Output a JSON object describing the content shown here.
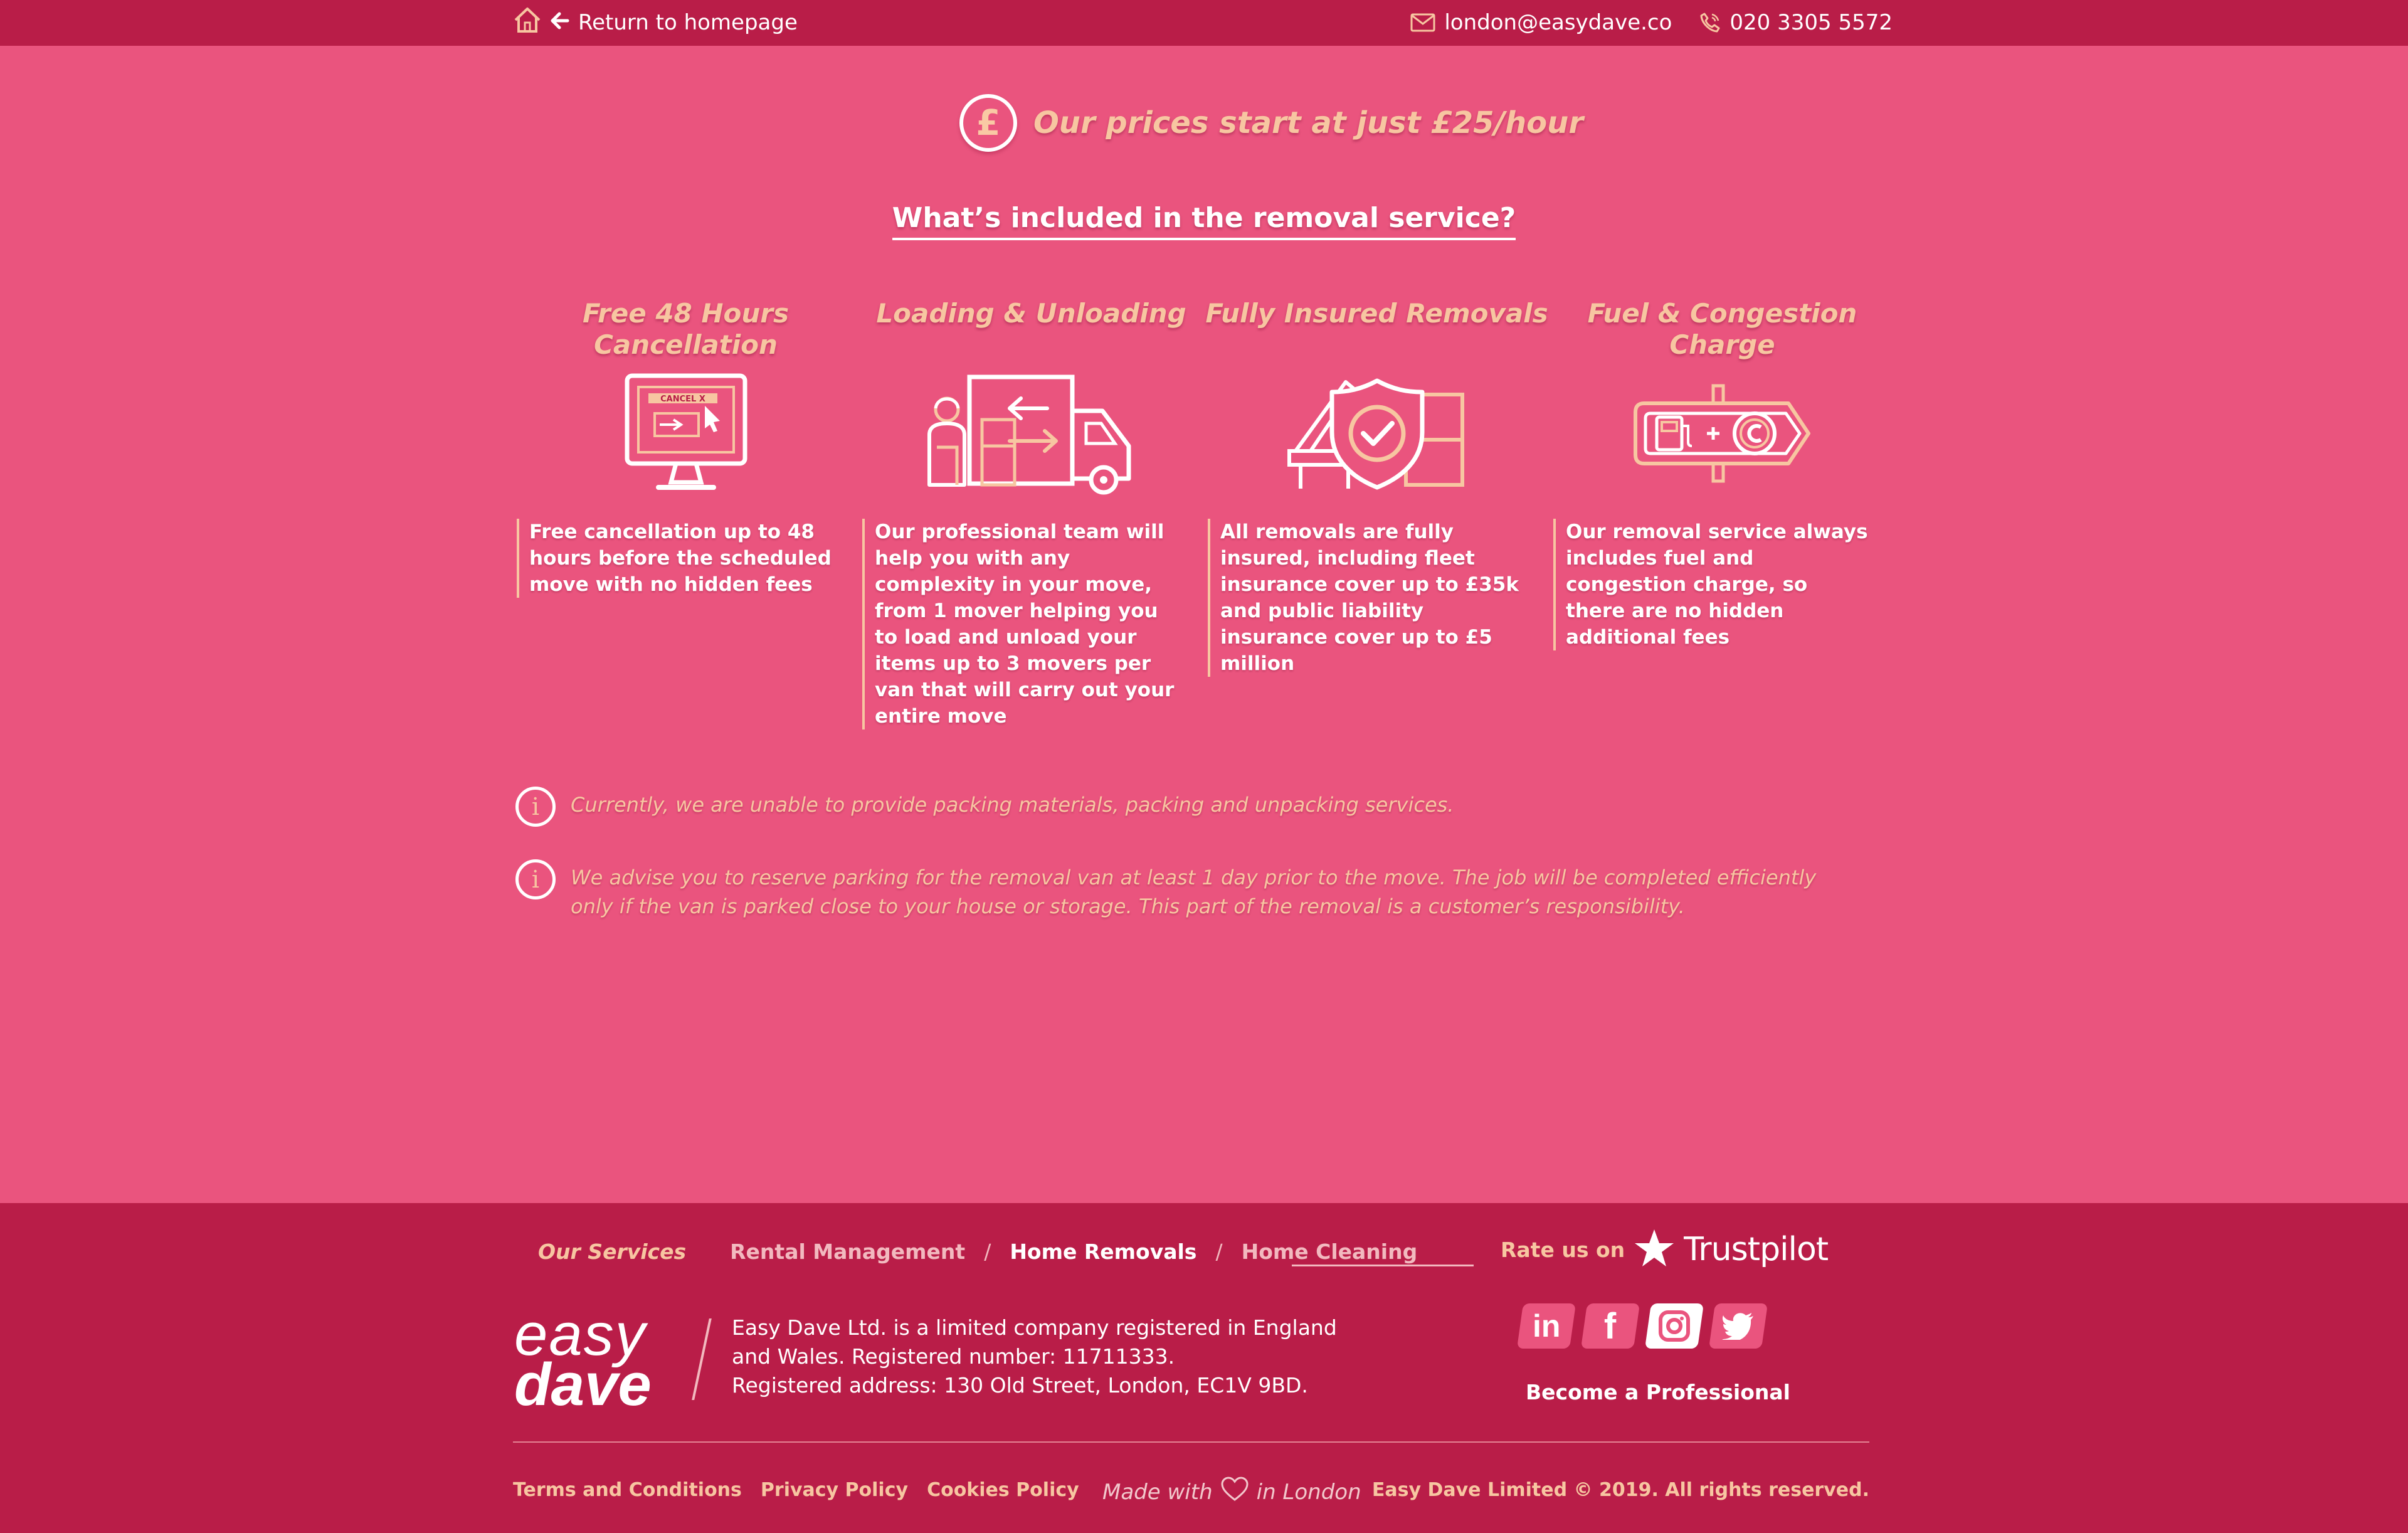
{
  "colors": {
    "page_bg": "#ea547e",
    "bar_bg": "#b91d48",
    "accent_peach": "#f7c6a1",
    "text_white": "#ffffff"
  },
  "topbar": {
    "home_icon": "home-icon",
    "back_icon": "arrow-left-icon",
    "return_label": "Return to homepage",
    "email_icon": "envelope-icon",
    "email": "london@easydave.co",
    "phone_icon": "phone-icon",
    "phone": "020 3305 5572"
  },
  "price": {
    "icon": "pound-icon",
    "symbol": "£",
    "text": "Our prices start at just £25/hour"
  },
  "included": {
    "title": "What’s included in the removal service?"
  },
  "features": [
    {
      "title": "Free 48 Hours Cancellation",
      "icon": "cancel-monitor-icon",
      "icon_text": "CANCEL X",
      "description": "Free cancellation up to 48 hours before the scheduled move with no hidden fees"
    },
    {
      "title": "Loading & Unloading",
      "icon": "mover-truck-icon",
      "description": "Our professional team will help you with any complexity in your move, from 1 mover helping you to load and unload your items up to 3 movers per van that will carry out your entire move"
    },
    {
      "title": "Fully Insured Removals",
      "icon": "shield-check-icon",
      "description": "All removals are fully insured, including fleet insurance cover up to £35k and public liability insurance cover up to £5 million"
    },
    {
      "title": "Fuel & Congestion Charge",
      "icon": "fuel-congestion-icon",
      "description": "Our removal service always includes fuel and congestion charge, so there are no hidden additional fees"
    }
  ],
  "notices": [
    {
      "icon": "info-icon",
      "text": "Currently, we are unable to provide packing materials, packing and unpacking services."
    },
    {
      "icon": "info-icon",
      "text": "We advise you to reserve parking for the removal van at least 1 day prior to the move. The job will be completed efficiently only if the van is parked close to your house or storage. This part of the removal is a customer’s responsibility."
    }
  ],
  "footer": {
    "nav_title": "Our Services",
    "nav_links": [
      "Rental Management",
      "Home Removals",
      "Home Cleaning"
    ],
    "nav_active": "Home Removals",
    "separator": "/",
    "rate_label": "Rate us on",
    "trustpilot": "Trustpilot",
    "logo_line1": "easy",
    "logo_line2": "dave",
    "company_lines": [
      "Easy Dave Ltd. is a limited company registered in England",
      "and Wales. Registered number: 11711333.",
      "Registered address: 130 Old Street, London, EC1V 9BD."
    ],
    "socials": [
      {
        "name": "linkedin",
        "icon": "linkedin-icon",
        "label": "in"
      },
      {
        "name": "facebook",
        "icon": "facebook-icon",
        "label": "f"
      },
      {
        "name": "instagram",
        "icon": "instagram-icon"
      },
      {
        "name": "twitter",
        "icon": "twitter-icon"
      }
    ],
    "become_pro": "Become a Professional",
    "bottom_links": [
      "Terms and Conditions",
      "Privacy Policy",
      "Cookies Policy"
    ],
    "made_with_pre": "Made with",
    "made_with_icon": "heart-icon",
    "made_with_post": "in London",
    "copyright": "Easy Dave Limited © 2019. All rights reserved."
  }
}
